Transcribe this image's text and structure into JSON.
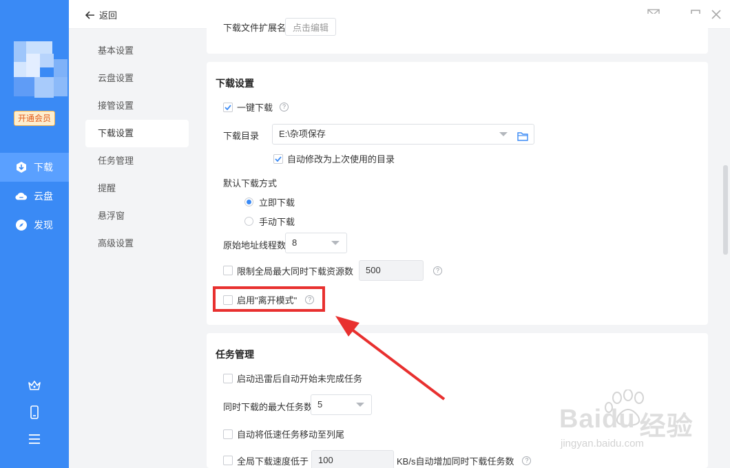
{
  "header": {
    "back_label": "返回"
  },
  "sidebar": {
    "vip_label": "开通会员",
    "nav": [
      {
        "label": "下载",
        "icon": "download-icon",
        "active": true
      },
      {
        "label": "云盘",
        "icon": "cloud-icon",
        "active": false
      },
      {
        "label": "发现",
        "icon": "compass-icon",
        "active": false
      }
    ],
    "bottom_icons": [
      "crown-icon",
      "phone-icon",
      "menu-icon"
    ]
  },
  "menu": {
    "items": [
      "基本设置",
      "云盘设置",
      "接管设置",
      "下载设置",
      "任务管理",
      "提醒",
      "悬浮窗",
      "高级设置"
    ],
    "active_index": 3
  },
  "top_card": {
    "partial_label": "下载文件扩展名",
    "partial_button": "点击编辑"
  },
  "download_settings": {
    "title": "下载设置",
    "one_click_label": "一键下载",
    "one_click_checked": true,
    "dir_label": "下载目录",
    "dir_value": "E:\\杂项保存",
    "auto_modify_label": "自动修改为上次使用的目录",
    "auto_modify_checked": true,
    "default_mode_label": "默认下载方式",
    "mode_immediate": "立即下载",
    "mode_manual": "手动下载",
    "selected_mode": "立即下载",
    "threads_label": "原始地址线程数",
    "threads_value": "8",
    "limit_label": "限制全局最大同时下载资源数",
    "limit_value": "500",
    "limit_checked": false,
    "away_mode_label": "启用\"离开模式\"",
    "away_mode_checked": false
  },
  "task_management": {
    "title": "任务管理",
    "auto_start_label": "启动迅雷后自动开始未完成任务",
    "max_tasks_label": "同时下载的最大任务数",
    "max_tasks_value": "5",
    "move_slow_label": "自动将低速任务移动至列尾",
    "speed_prefix": "全局下载速度低于",
    "speed_value": "100",
    "speed_suffix": "KB/s自动增加同时下载任务数"
  },
  "watermark": {
    "brand": "Baidu",
    "brand_cn": "经验",
    "url": "jingyan.baidu.com"
  },
  "colors": {
    "primary": "#3a8af5",
    "highlight": "#e8302f"
  }
}
